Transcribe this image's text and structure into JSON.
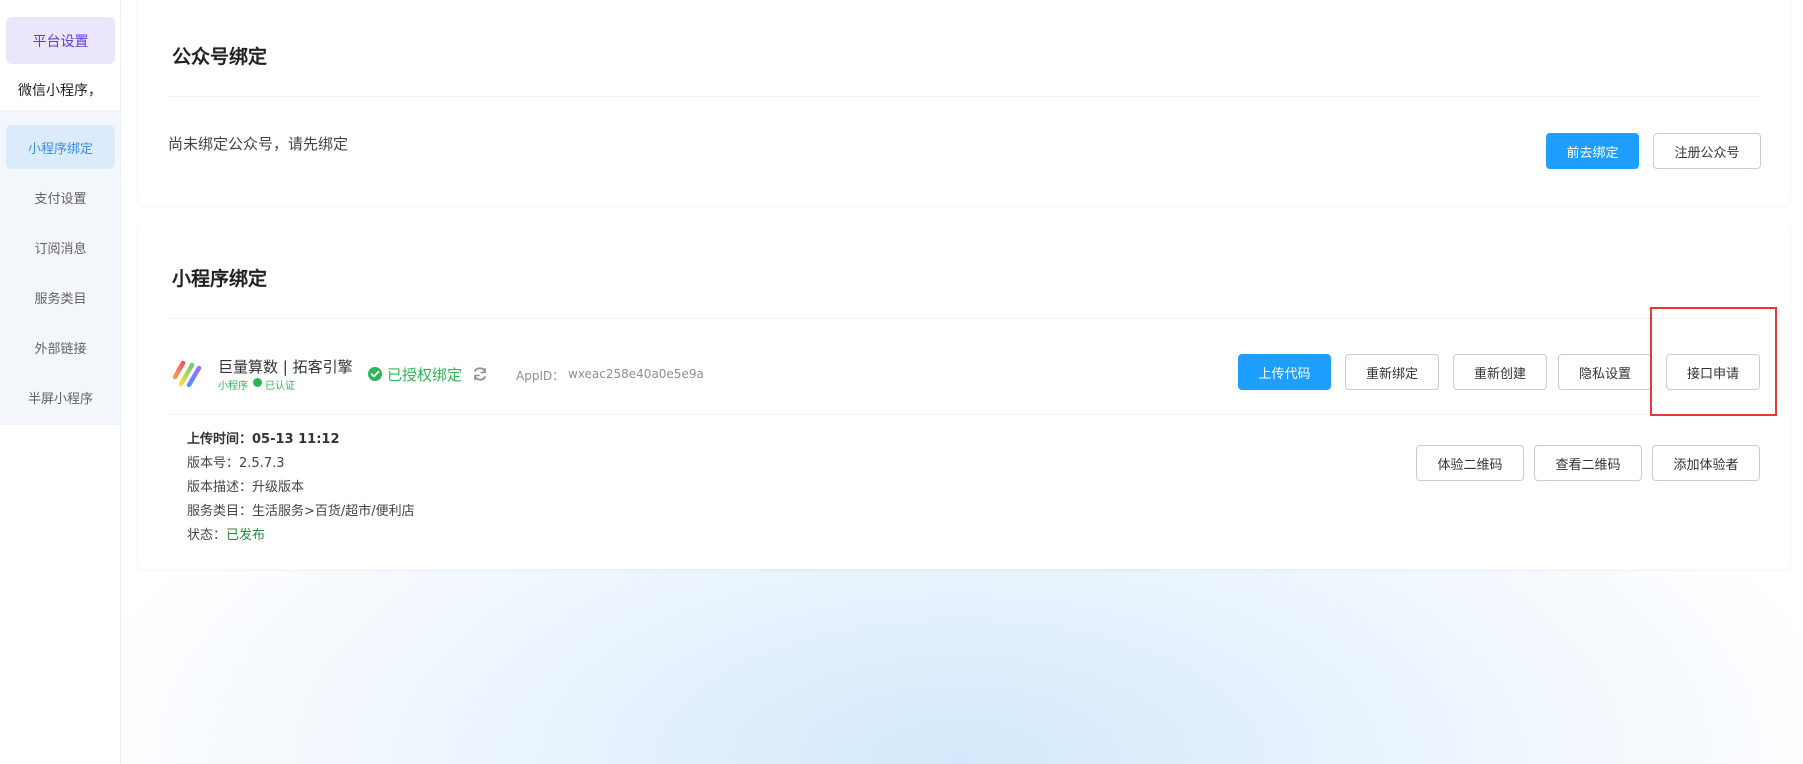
{
  "sidebar": {
    "top_item": "平台设置",
    "group_label": "微信小程序，",
    "items": [
      {
        "label": "小程序绑定",
        "active": true
      },
      {
        "label": "支付设置"
      },
      {
        "label": "订阅消息"
      },
      {
        "label": "服务类目"
      },
      {
        "label": "外部链接"
      },
      {
        "label": "半屏小程序"
      }
    ]
  },
  "official_account": {
    "title": "公众号绑定",
    "status_text": "尚未绑定公众号，请先绑定",
    "bind_button": "前去绑定",
    "register_button": "注册公众号"
  },
  "mini_program": {
    "title": "小程序绑定",
    "app_name": "巨量算数 | 拓客引擎",
    "app_tag": "小程序",
    "verified_tag": "已认证",
    "auth_status": "已授权绑定",
    "appid_label": "AppID：",
    "appid_value": "wxeac258e40a0e5e9a",
    "buttons": {
      "upload": "上传代码",
      "rebind": "重新绑定",
      "recreate": "重新创建",
      "privacy": "隐私设置",
      "api_apply": "接口申请"
    },
    "version": {
      "upload_time_label": "上传时间：",
      "upload_time": "05-13 11:12",
      "version_label": "版本号：",
      "version": "2.5.7.3",
      "desc_label": "版本描述：",
      "desc": "升级版本",
      "category_label": "服务类目：",
      "category": "生活服务>百货/超市/便利店",
      "status_label": "状态：",
      "status": "已发布"
    },
    "version_buttons": {
      "trial_qr": "体验二维码",
      "view_qr": "查看二维码",
      "add_tester": "添加体验者"
    }
  },
  "colors": {
    "primary": "#1e9fff",
    "success": "#2fb45a",
    "published": "#1e8e3e",
    "highlight": "#e53935"
  }
}
